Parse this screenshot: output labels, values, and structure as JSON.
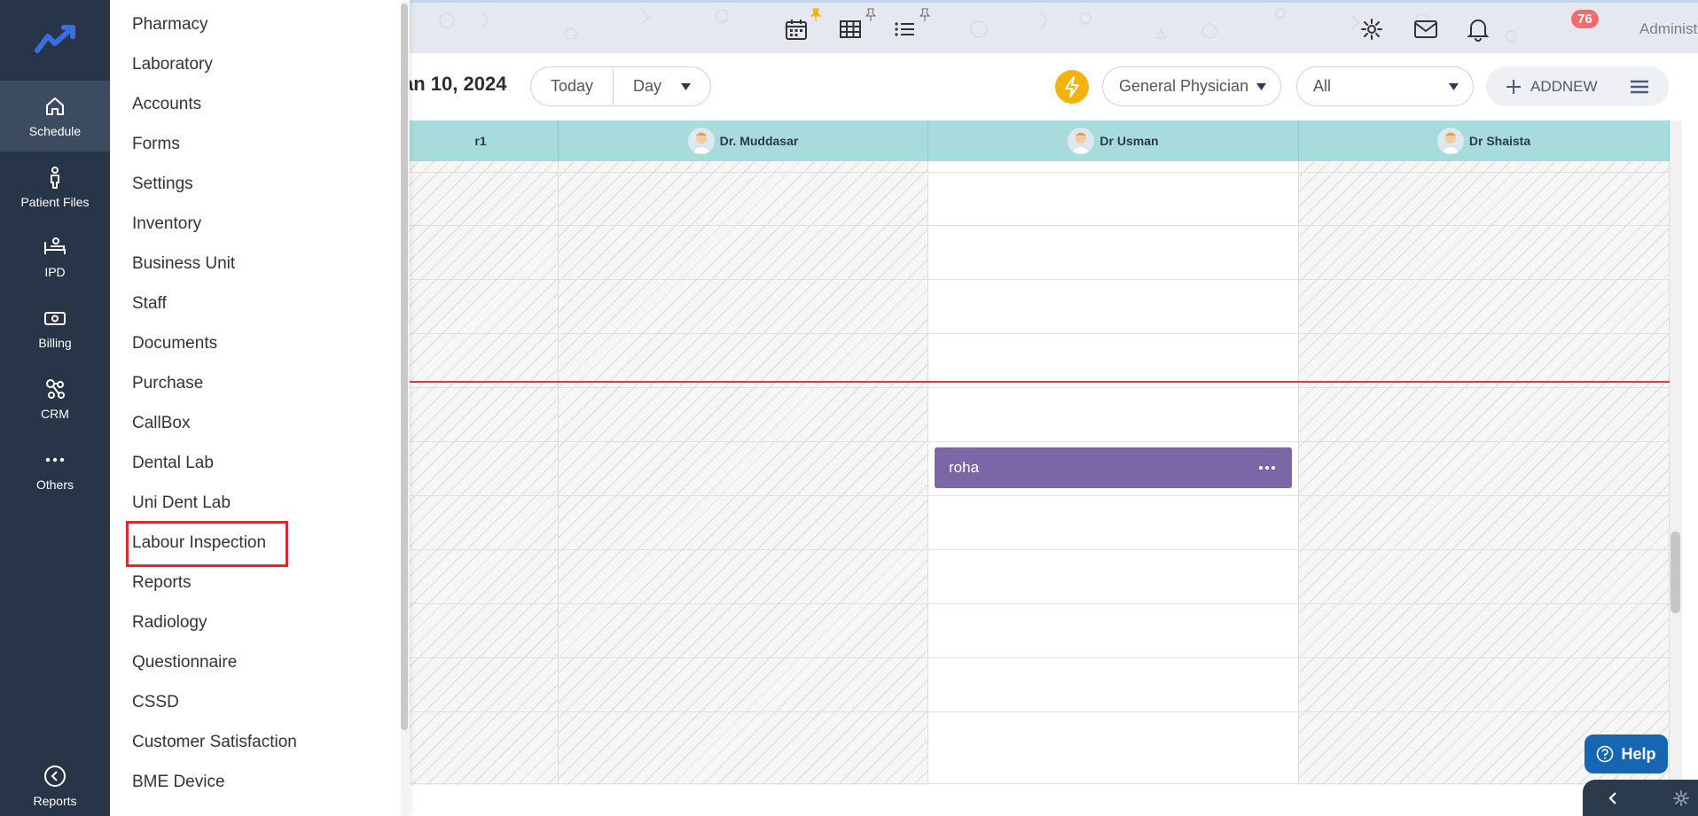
{
  "sidebar": {
    "items": [
      {
        "label": "Schedule",
        "icon": "home-icon"
      },
      {
        "label": "Patient Files",
        "icon": "person-icon"
      },
      {
        "label": "IPD",
        "icon": "bed-icon"
      },
      {
        "label": "Billing",
        "icon": "money-icon"
      },
      {
        "label": "CRM",
        "icon": "network-icon"
      },
      {
        "label": "Others",
        "icon": "more-dots-icon"
      },
      {
        "label": "Reports",
        "icon": "back-circle-icon"
      }
    ]
  },
  "header": {
    "notification_count": "76",
    "user_name": "Administrator"
  },
  "toolbar": {
    "date_title": "an 10, 2024",
    "today_label": "Today",
    "view_label": "Day",
    "specialty_value": "General Physician",
    "filter_value": "All",
    "addnew_label": "ADDNEW"
  },
  "calendar": {
    "columns": [
      {
        "name": "r1"
      },
      {
        "name": "Dr. Muddasar"
      },
      {
        "name": "Dr Usman"
      },
      {
        "name": "Dr Shaista"
      }
    ],
    "appointment": {
      "title": "roha",
      "more": "···"
    }
  },
  "menu": {
    "items": [
      "Pharmacy",
      "Laboratory",
      "Accounts",
      "Forms",
      "Settings",
      "Inventory",
      "Business Unit",
      "Staff",
      "Documents",
      "Purchase",
      "CallBox",
      "Dental Lab",
      "Uni Dent Lab",
      "Labour Inspection",
      "Reports",
      "Radiology",
      "Questionnaire",
      "CSSD",
      "Customer Satisfaction",
      "BME Device"
    ],
    "highlighted": "Labour Inspection"
  },
  "help": {
    "label": "Help"
  },
  "colors": {
    "sidebar_bg": "#283548",
    "accent_blue": "#1766b3",
    "appointment": "#7b66a6",
    "header_teal": "#a8dcdc",
    "highlight_red": "#e3262b"
  }
}
